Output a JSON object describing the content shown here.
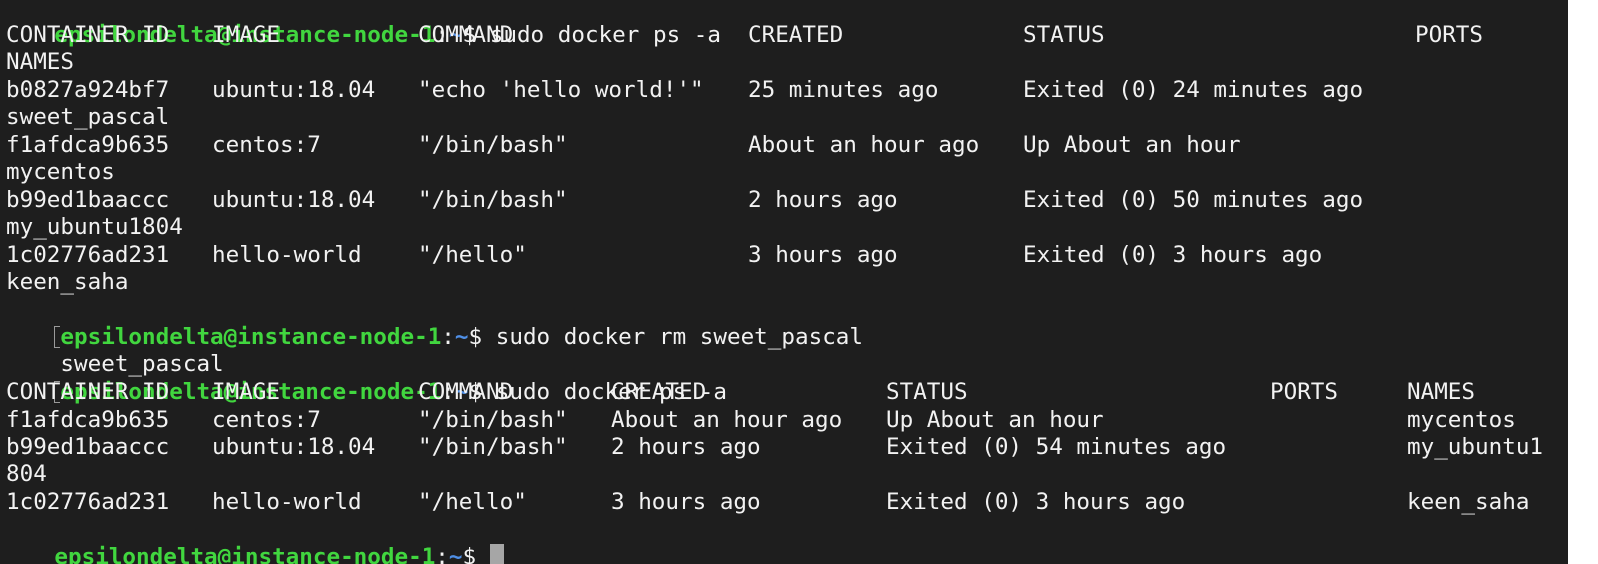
{
  "terminal": {
    "prompt": {
      "user_host": "epsilondelta@instance-node-1",
      "colon": ":",
      "path": "~",
      "symbol": "$ "
    },
    "commands": [
      "sudo docker ps -a",
      "sudo docker rm sweet_pascal",
      "sudo docker ps -a"
    ],
    "first_listing": {
      "headers": [
        "CONTAINER ID",
        "IMAGE",
        "COMMAND",
        "CREATED",
        "STATUS",
        "PORTS",
        "NAMES"
      ],
      "rows": [
        {
          "id": "b0827a924bf7",
          "image": "ubuntu:18.04",
          "command": "\"echo 'hello world!'\"",
          "created": "25 minutes ago",
          "status": "Exited (0) 24 minutes ago",
          "name": "sweet_pascal"
        },
        {
          "id": "f1afdca9b635",
          "image": "centos:7",
          "command": "\"/bin/bash\"",
          "created": "About an hour ago",
          "status": "Up About an hour",
          "name": "mycentos"
        },
        {
          "id": "b99ed1baaccc",
          "image": "ubuntu:18.04",
          "command": "\"/bin/bash\"",
          "created": "2 hours ago",
          "status": "Exited (0) 50 minutes ago",
          "name": "my_ubuntu1804"
        },
        {
          "id": "1c02776ad231",
          "image": "hello-world",
          "command": "\"/hello\"",
          "created": "3 hours ago",
          "status": "Exited (0) 3 hours ago",
          "name": "keen_saha"
        }
      ]
    },
    "rm_output": "sweet_pascal",
    "second_listing": {
      "headers": [
        "CONTAINER ID",
        "IMAGE",
        "COMMAND",
        "CREATED",
        "STATUS",
        "PORTS",
        "NAMES"
      ],
      "rows": [
        {
          "id": "f1afdca9b635",
          "image": "centos:7",
          "command": "\"/bin/bash\"",
          "created": "About an hour ago",
          "status": "Up About an hour",
          "name": "mycentos"
        },
        {
          "id": "b99ed1baaccc",
          "image": "ubuntu:18.04",
          "command": "\"/bin/bash\"",
          "created": "2 hours ago",
          "status": "Exited (0) 54 minutes ago",
          "name": "my_ubuntu1",
          "name_wrap": "804"
        },
        {
          "id": "1c02776ad231",
          "image": "hello-world",
          "command": "\"/hello\"",
          "created": "3 hours ago",
          "status": "Exited (0) 3 hours ago",
          "name": "keen_saha"
        }
      ]
    },
    "colors": {
      "background": "#1e1e1e",
      "text": "#f2f2f2",
      "user_host": "#41d63f",
      "path": "#4f8fe6"
    }
  }
}
